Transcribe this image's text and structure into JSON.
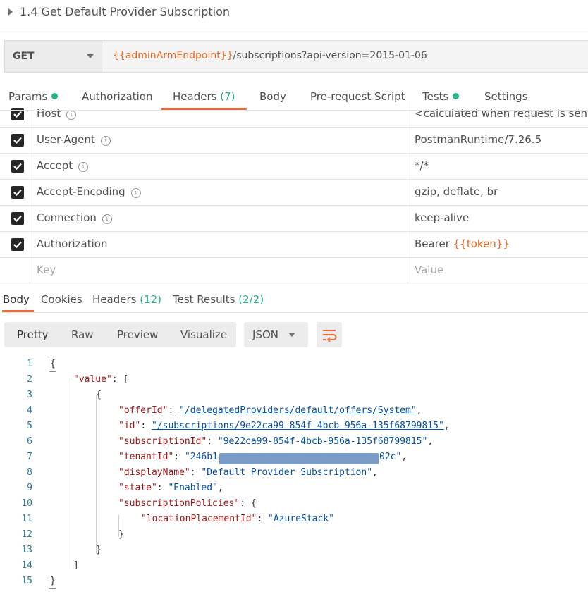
{
  "title": "1.4 Get Default Provider Subscription",
  "request": {
    "method": "GET",
    "url_variable": "{{adminArmEndpoint}}",
    "url_rest": "/subscriptions?api-version=2015-01-06"
  },
  "request_tabs": [
    {
      "label": "Params"
    },
    {
      "label": "Authorization"
    },
    {
      "label": "Headers",
      "count": "(7)"
    },
    {
      "label": "Body"
    },
    {
      "label": "Pre-request Script"
    },
    {
      "label": "Tests"
    },
    {
      "label": "Settings"
    }
  ],
  "headers": [
    {
      "key": "Host",
      "value": "<calculated when request is sent>"
    },
    {
      "key": "User-Agent",
      "value": "PostmanRuntime/7.26.5"
    },
    {
      "key": "Accept",
      "value": "*/*"
    },
    {
      "key": "Accept-Encoding",
      "value": "gzip, deflate, br"
    },
    {
      "key": "Connection",
      "value": "keep-alive"
    },
    {
      "key": "Authorization",
      "value_prefix": "Bearer",
      "value_var": "{{token}}"
    }
  ],
  "headers_placeholder": {
    "key": "Key",
    "value": "Value"
  },
  "response_tabs": [
    {
      "label": "Body"
    },
    {
      "label": "Cookies"
    },
    {
      "label": "Headers",
      "count": "(12)"
    },
    {
      "label": "Test Results",
      "count": "(2/2)"
    }
  ],
  "view_modes": [
    "Pretty",
    "Raw",
    "Preview",
    "Visualize"
  ],
  "format": "JSON",
  "line_numbers": [
    "1",
    "2",
    "3",
    "4",
    "5",
    "6",
    "7",
    "8",
    "9",
    "10",
    "11",
    "12",
    "13",
    "14",
    "15"
  ],
  "json_body": {
    "value_key": "\"value\"",
    "offerId_key": "\"offerId\"",
    "offerId_val": "\"/delegatedProviders/default/offers/System\"",
    "id_key": "\"id\"",
    "id_val": "\"/subscriptions/9e22ca99-854f-4bcb-956a-135f68799815\"",
    "subscriptionId_key": "\"subscriptionId\"",
    "subscriptionId_val": "\"9e22ca99-854f-4bcb-956a-135f68799815\"",
    "tenantId_key": "\"tenantId\"",
    "tenantId_start": "\"246b1",
    "tenantId_end": "02c\"",
    "displayName_key": "\"displayName\"",
    "displayName_val": "\"Default Provider Subscription\"",
    "state_key": "\"state\"",
    "state_val": "\"Enabled\"",
    "subscriptionPolicies_key": "\"subscriptionPolicies\"",
    "locationPlacementId_key": "\"locationPlacementId\"",
    "locationPlacementId_val": "\"AzureStack\""
  },
  "colors": {
    "accent": "#f26b3a",
    "success": "#26b47f",
    "variable": "#e8691f"
  }
}
